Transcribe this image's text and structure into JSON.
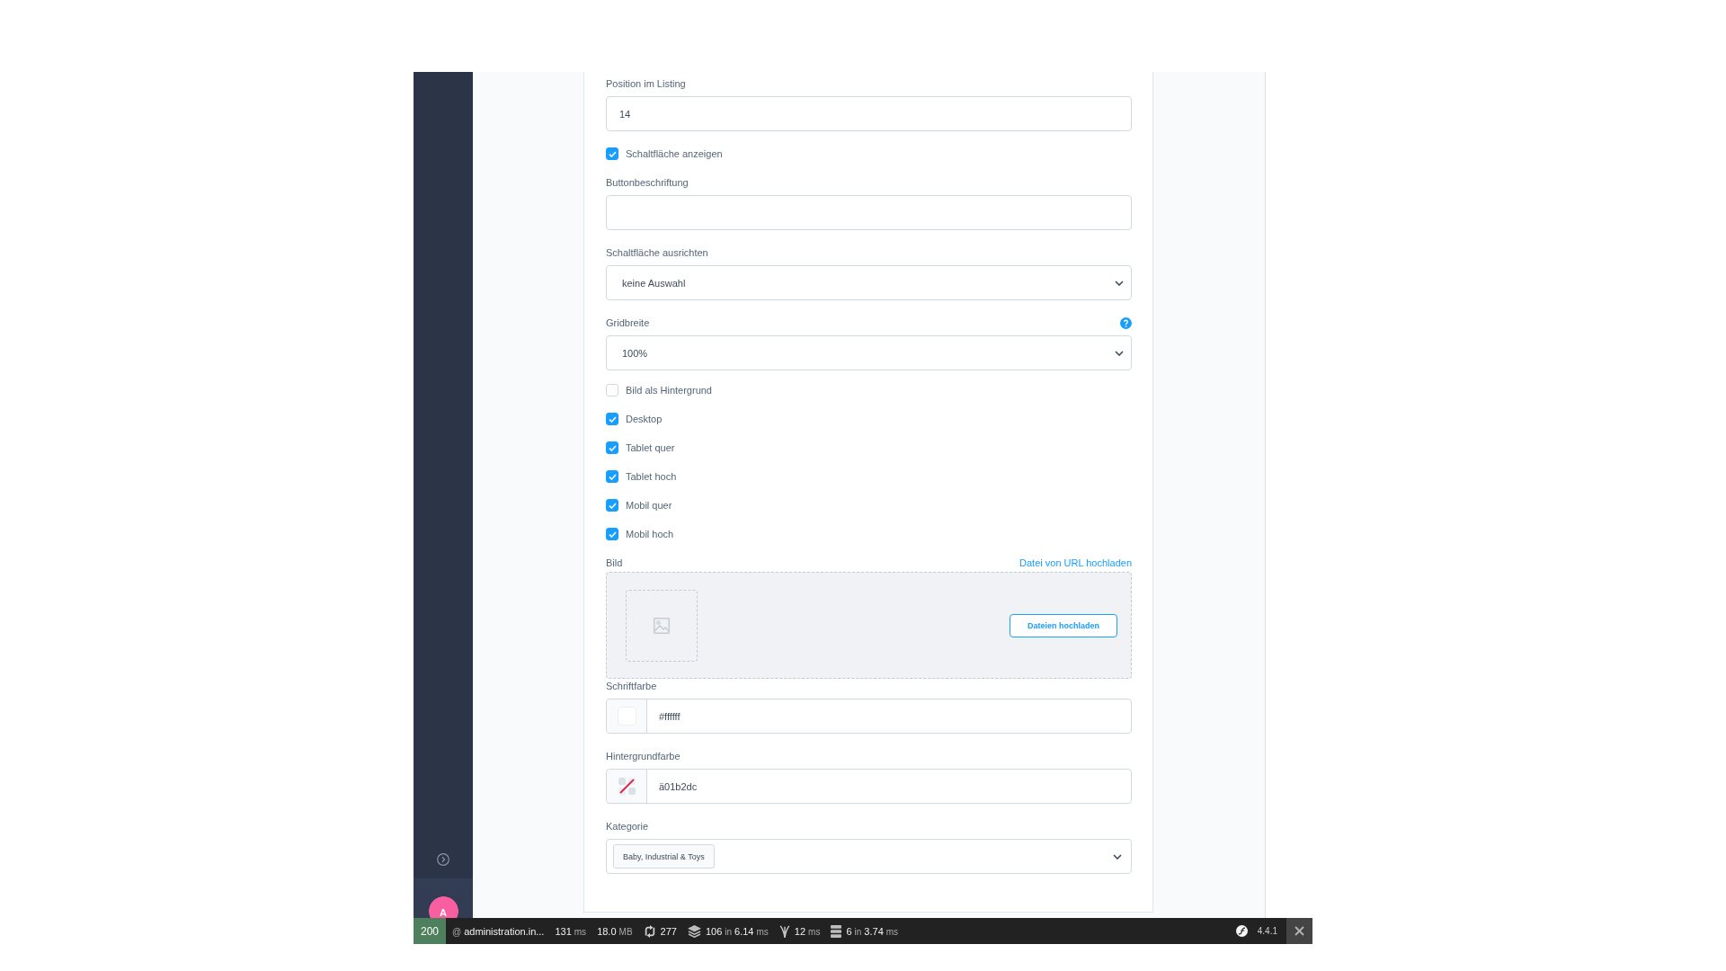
{
  "sidebar": {
    "avatar": {
      "initial": "A"
    }
  },
  "form": {
    "fields": [
      {
        "kind": "input",
        "label": "Position im Listing",
        "value": "14"
      },
      {
        "kind": "checkbox",
        "label": "Schaltfläche anzeigen",
        "checked": true
      },
      {
        "kind": "input",
        "label": "Buttonbeschriftung"
      },
      {
        "kind": "select",
        "label": "Schaltfläche ausrichten",
        "value": "keine Auswahl"
      },
      {
        "kind": "select",
        "label": "Gridbreite",
        "value": "100%",
        "help": true
      },
      {
        "kind": "checkbox",
        "label": "Bild als Hintergrund",
        "checked": false
      },
      {
        "kind": "checkbox",
        "label": "Desktop",
        "checked": true
      },
      {
        "kind": "checkbox",
        "label": "Tablet quer",
        "checked": true
      },
      {
        "kind": "checkbox",
        "label": "Tablet hoch",
        "checked": true
      },
      {
        "kind": "checkbox",
        "label": "Mobil quer",
        "checked": true
      },
      {
        "kind": "checkbox",
        "label": "Mobil hoch",
        "checked": true
      },
      {
        "kind": "upload",
        "label": "Bild",
        "link": "Datei von URL hochladen",
        "button": "Dateien hochladen"
      },
      {
        "kind": "color",
        "label": "Schriftfarbe",
        "value": "#ffffff",
        "color": "#ffffff"
      },
      {
        "kind": "color",
        "label": "Hintergrundfarbe",
        "value": "ä01b2dc"
      },
      {
        "kind": "multiselect",
        "label": "Kategorie",
        "tags": [
          "Baby, Industrial & Toys"
        ]
      }
    ]
  },
  "status_bar": {
    "status": {
      "code": "200",
      "kind": "success"
    },
    "metrics": [
      {
        "kind": "plain",
        "parts": [
          {
            "text": "@",
            "muted": true
          },
          {
            "text": "administration.in...",
            "muted": false
          }
        ]
      },
      {
        "kind": "plain",
        "parts": [
          {
            "text": "131",
            "muted": false
          },
          {
            "text": "ms",
            "muted": true
          }
        ]
      },
      {
        "kind": "plain",
        "parts": [
          {
            "text": "18.0",
            "muted": false
          },
          {
            "text": "MB",
            "muted": true
          }
        ]
      },
      {
        "kind": "sync",
        "parts": [
          {
            "text": "277",
            "muted": false
          }
        ]
      },
      {
        "kind": "layers",
        "parts": [
          {
            "text": "106",
            "muted": false
          },
          {
            "text": "in",
            "muted": true
          },
          {
            "text": "6.14",
            "muted": false
          },
          {
            "text": "ms",
            "muted": true
          }
        ]
      },
      {
        "kind": "branch",
        "parts": [
          {
            "text": "12",
            "muted": false
          },
          {
            "text": "ms",
            "muted": true
          }
        ]
      },
      {
        "kind": "server",
        "parts": [
          {
            "text": "6",
            "muted": false
          },
          {
            "text": "in",
            "muted": true
          },
          {
            "text": "3.74",
            "muted": false
          },
          {
            "text": "ms",
            "muted": true
          }
        ]
      }
    ],
    "version": "4.4.1"
  }
}
